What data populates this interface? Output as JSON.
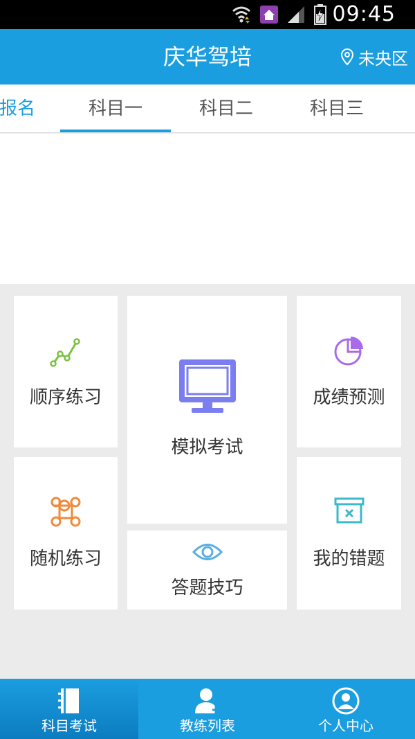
{
  "status_bar": {
    "time": "09:45"
  },
  "header": {
    "title": "庆华驾培",
    "location": "未央区"
  },
  "tabs": [
    {
      "label": "报名",
      "active": false
    },
    {
      "label": "科目一",
      "active": true
    },
    {
      "label": "科目二",
      "active": false
    },
    {
      "label": "科目三",
      "active": false
    }
  ],
  "menu": {
    "sequential_practice": "顺序练习",
    "mock_exam": "模拟考试",
    "score_prediction": "成绩预测",
    "random_practice": "随机练习",
    "answer_tips": "答题技巧",
    "my_mistakes": "我的错题"
  },
  "bottom_nav": [
    {
      "label": "科目考试",
      "active": true
    },
    {
      "label": "教练列表",
      "active": false
    },
    {
      "label": "个人中心",
      "active": false
    }
  ],
  "colors": {
    "primary": "#1b9ee0",
    "green_icon": "#7ac143",
    "purple_icon": "#7b7ef0",
    "orange_icon": "#f08a3c",
    "teal_icon": "#3bb8c9",
    "blue_icon": "#5aaee0"
  },
  "icons": {
    "wifi": "wifi-icon",
    "home": "home-icon",
    "signal": "signal-icon",
    "battery": "battery-icon",
    "location": "location-pin-icon",
    "sequential": "line-chart-icon",
    "mock": "monitor-icon",
    "prediction": "pie-chart-icon",
    "random": "command-icon",
    "tips": "eye-icon",
    "mistakes": "box-x-icon",
    "nav_exam": "notebook-icon",
    "nav_coach": "user-add-icon",
    "nav_profile": "user-circle-icon"
  }
}
